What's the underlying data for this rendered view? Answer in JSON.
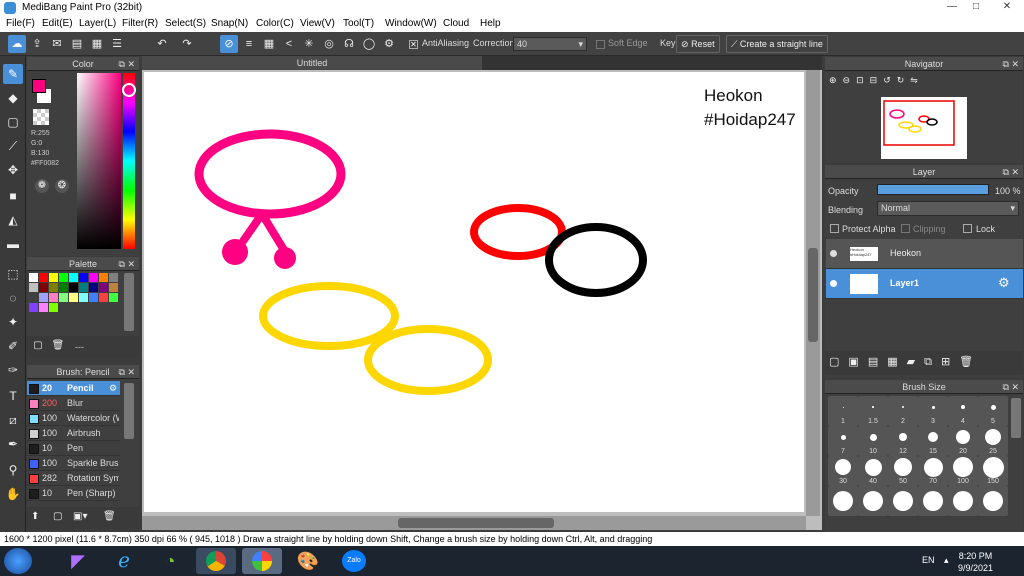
{
  "window": {
    "title": "MediBang Paint Pro (32bit)",
    "controls": [
      "—",
      "□",
      "✕"
    ]
  },
  "menu": [
    "File(F)",
    "Edit(E)",
    "Layer(L)",
    "Filter(R)",
    "Select(S)",
    "Snap(N)",
    "Color(C)",
    "View(V)",
    "Tool(T)",
    "Window(W)",
    "Cloud",
    "Help"
  ],
  "toolbar": {
    "antialiasing_label": "AntiAliasing",
    "correction_label": "Correction",
    "correction_value": "40",
    "soft_edge_label": "Soft Edge",
    "key_label": "Key",
    "reset_label": "Reset",
    "straight_line_label": "Create a straight line"
  },
  "canvas": {
    "tab_title": "Untitled",
    "text_line1": "Heokon",
    "text_line2": "#Hoidap247"
  },
  "color_panel": {
    "title": "Color",
    "r": "R:255",
    "g": "G:0",
    "b": "B:130",
    "hex": "#FF0082",
    "primary_color": "#FF0082"
  },
  "palette_panel": {
    "title": "Palette",
    "footer": "---",
    "colors": [
      "#ffffff",
      "#ff0000",
      "#ffff00",
      "#00ff00",
      "#00ffff",
      "#0000ff",
      "#ff00ff",
      "#ff8000",
      "#808080",
      "#c0c0c0",
      "#800000",
      "#808000",
      "#008000",
      "#000000",
      "#008080",
      "#000080",
      "#800080",
      "#c08040",
      "#404040",
      "#a0a0ff",
      "#ff80c0",
      "#80ff80",
      "#ffff80",
      "#80ffff",
      "#4080ff",
      "#ff4040",
      "#40ff40",
      "#8040ff",
      "#ff80ff",
      "#80ff00"
    ]
  },
  "brush_panel": {
    "title": "Brush: Pencil",
    "items": [
      {
        "size": "20",
        "name": "Pencil",
        "color": "#1e1e1e"
      },
      {
        "size": "200",
        "name": "Blur",
        "color": "#ff80c0"
      },
      {
        "size": "100",
        "name": "Watercolor (W",
        "color": "#80e0ff"
      },
      {
        "size": "100",
        "name": "Airbrush",
        "color": "#d0d0d0"
      },
      {
        "size": "10",
        "name": "Pen",
        "color": "#1e1e1e"
      },
      {
        "size": "100",
        "name": "Sparkle Brush",
        "color": "#4060ff"
      },
      {
        "size": "282",
        "name": "Rotation Sym",
        "color": "#ff4040"
      },
      {
        "size": "10",
        "name": "Pen (Sharp)",
        "color": "#1e1e1e"
      }
    ]
  },
  "navigator_panel": {
    "title": "Navigator"
  },
  "layer_panel": {
    "title": "Layer",
    "opacity_label": "Opacity",
    "opacity_value": "100 %",
    "opacity_fraction": 1.0,
    "blending_label": "Blending",
    "blending_value": "Normal",
    "protect_alpha_label": "Protect Alpha",
    "clipping_label": "Clipping",
    "lock_label": "Lock",
    "layers": [
      {
        "name": "Heokon",
        "thumb_text": "Heokon #Hoidap247"
      },
      {
        "name": "Layer1"
      }
    ]
  },
  "brush_size_panel": {
    "title": "Brush Size",
    "sizes": [
      "1",
      "1.5",
      "2",
      "3",
      "4",
      "5",
      "7",
      "10",
      "12",
      "15",
      "20",
      "25",
      "30",
      "40",
      "50",
      "70",
      "100",
      "150",
      "",
      "",
      "",
      "",
      "",
      ""
    ]
  },
  "status": {
    "text": "1600 * 1200 pixel   (11.6 * 8.7cm)   350 dpi   66 %   ( 945, 1018 )   Draw a straight line by holding down Shift, Change a brush size by holding down Ctrl, Alt, and dragging"
  },
  "taskbar": {
    "lang": "EN",
    "time": "8:20 PM",
    "date": "9/9/2021",
    "zalo_label": "Zalo"
  }
}
